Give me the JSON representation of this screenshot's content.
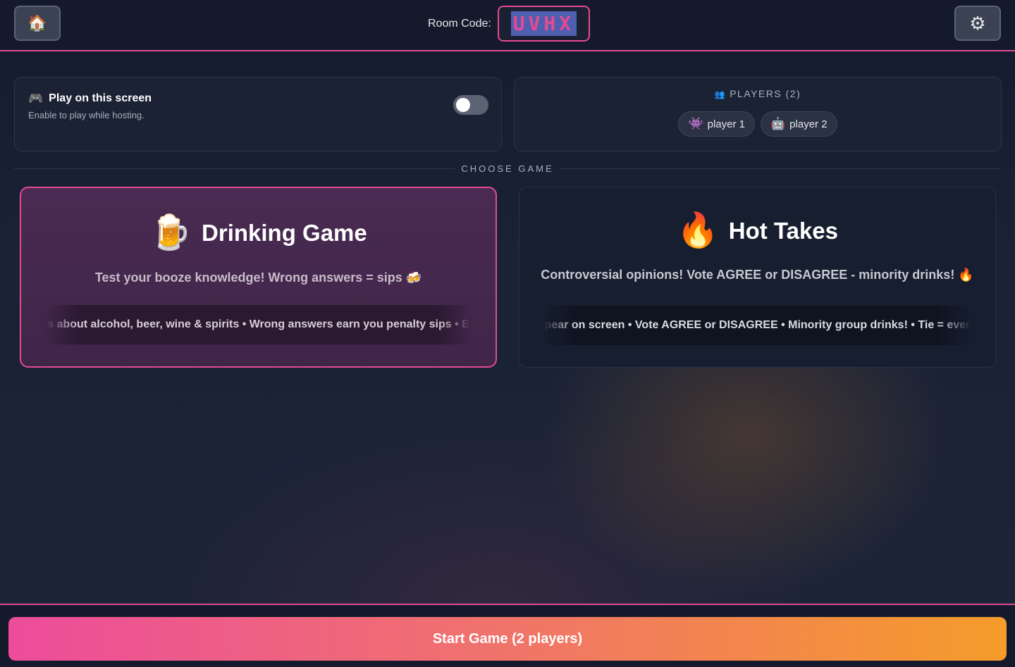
{
  "header": {
    "home_icon": "🏠",
    "settings_icon": "⚙",
    "room_label": "Room Code:",
    "room_code": "UVHX"
  },
  "play_panel": {
    "icon": "🎮",
    "title": "Play on this screen",
    "subtitle": "Enable to play while hosting.",
    "toggle_on": false
  },
  "players_panel": {
    "icon": "👥",
    "title": "PLAYERS (2)",
    "players": [
      {
        "avatar": "👾",
        "name": "player 1"
      },
      {
        "avatar": "🤖",
        "name": "player 2"
      }
    ]
  },
  "section_title": "CHOOSE GAME",
  "games": [
    {
      "emoji": "🍺",
      "title": "Drinking Game",
      "description": "Test your booze knowledge! Wrong answers = sips 🍻",
      "ticker": "s about alcohol, beer, wine & spirits • Wrong answers earn you penalty sips • E",
      "selected": true
    },
    {
      "emoji": "🔥",
      "title": "Hot Takes",
      "description": "Controversial opinions! Vote AGREE or DISAGREE - minority drinks! 🔥",
      "ticker": "pear on screen • Vote AGREE or DISAGREE • Minority group drinks! • Tie = ever",
      "selected": false
    }
  ],
  "footer": {
    "start_label": "Start Game (2 players)"
  },
  "colors": {
    "accent": "#e44a93",
    "button_gradient_start": "#ec4c9b",
    "button_gradient_end": "#f59c2a"
  }
}
